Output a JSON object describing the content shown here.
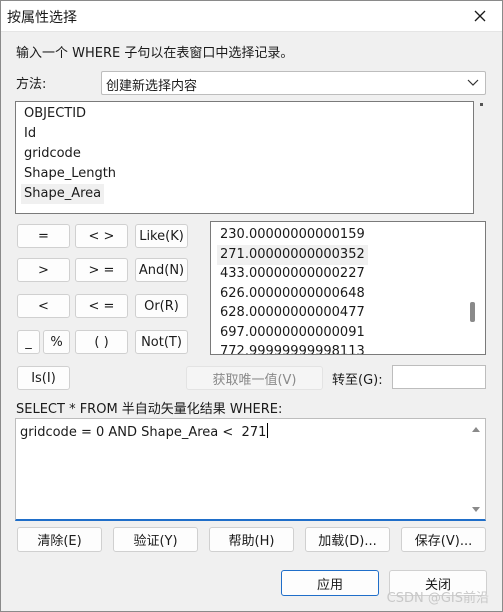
{
  "window": {
    "title": "按属性选择"
  },
  "instruction": "输入一个 WHERE 子句以在表窗口中选择记录。",
  "method": {
    "label": "方法:",
    "value": "创建新选择内容"
  },
  "fields": [
    "OBJECTID",
    "Id",
    "gridcode",
    "Shape_Length",
    "Shape_Area"
  ],
  "selected_field": "Shape_Area",
  "operators": {
    "eq": "=",
    "ne": "< >",
    "like": "Like(K)",
    "gt": ">",
    "ge": "> =",
    "and": "And(N)",
    "lt": "<",
    "le": "< =",
    "or": "Or(R)",
    "underscore": "_",
    "percent": "%",
    "parens": "( )",
    "not": "Not(T)",
    "is": "Is(I)"
  },
  "values": [
    "230.00000000000159",
    "271.00000000000352",
    "433.00000000000227",
    "626.00000000000648",
    "628.00000000000477",
    "697.00000000000091",
    "772.99999999998113"
  ],
  "selected_value": "271.00000000000352",
  "get_unique_button": "获取唯一值(V)",
  "goto_label": "转至(G):",
  "goto_value": "",
  "sql_prefix": "SELECT * FROM 半自动矢量化结果 WHERE:",
  "where_clause": "gridcode = 0 AND Shape_Area <  271",
  "actions": {
    "clear": "清除(E)",
    "verify": "验证(Y)",
    "help": "帮助(H)",
    "load": "加载(D)...",
    "save": "保存(V)..."
  },
  "dialog_buttons": {
    "apply": "应用",
    "close": "关闭"
  },
  "watermark": "CSDN @GIS前沿",
  "colors": {
    "accent": "#1f6ec9",
    "window_bg": "#f0f0f0",
    "selection": "#f0f0f0"
  }
}
